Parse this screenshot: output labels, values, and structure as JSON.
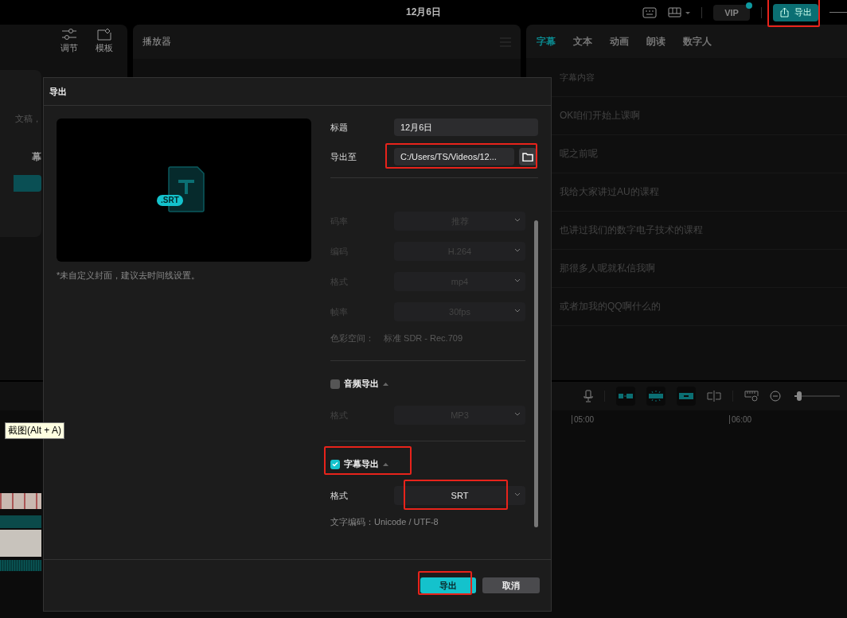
{
  "titlebar": {
    "title": "12月6日",
    "vip": "VIP",
    "export_button": "导出"
  },
  "left_panel": {
    "tabs": [
      {
        "label": "调节",
        "kind": "adjust"
      },
      {
        "label": "模板",
        "kind": "template"
      }
    ],
    "card": {
      "text": "文稿，",
      "heading": "幕"
    }
  },
  "player": {
    "title": "播放器"
  },
  "subtitle_panel": {
    "tabs": [
      {
        "label": "字幕",
        "selected": true
      },
      {
        "label": "文本",
        "selected": false
      },
      {
        "label": "动画",
        "selected": false
      },
      {
        "label": "朗读",
        "selected": false
      },
      {
        "label": "数字人",
        "selected": false
      }
    ],
    "header": "字幕内容",
    "lines": [
      "OK咱们开始上课啊",
      "呢之前呢",
      "我给大家讲过AU的课程",
      "也讲过我们的数字电子技术的课程",
      "那很多人呢就私信我啊",
      "或者加我的QQ啊什么的"
    ]
  },
  "timeline": {
    "ruler": [
      "05:00",
      "06:00"
    ],
    "tooltip": "截图(Alt + A)",
    "zoom": {
      "level": 0.12
    }
  },
  "export_dialog": {
    "title": "导出",
    "file_badge": ".SRT",
    "cover_caption": "*未自定义封面，建议去时间线设置。",
    "fields": [
      {
        "label": "标题",
        "value": "12月6日",
        "kind": "text"
      },
      {
        "label": "导出至",
        "value": "C:/Users/TS/Videos/12...",
        "kind": "path"
      }
    ],
    "settings": [
      {
        "label": "码率",
        "value": "推荐",
        "disabled": true
      },
      {
        "label": "编码",
        "value": "H.264",
        "disabled": true
      },
      {
        "label": "格式",
        "value": "mp4",
        "disabled": true
      },
      {
        "label": "帧率",
        "value": "30fps",
        "disabled": true
      }
    ],
    "color_space": {
      "label": "色彩空间：",
      "value": "标准 SDR - Rec.709"
    },
    "sections": [
      {
        "title": "音频导出",
        "checked": false,
        "rows": [
          {
            "label": "格式",
            "value": "MP3",
            "disabled": true
          }
        ]
      },
      {
        "title": "字幕导出",
        "checked": true,
        "rows": [
          {
            "label": "格式",
            "value": "SRT",
            "disabled": false
          }
        ],
        "note": "文字编码：Unicode / UTF-8"
      }
    ],
    "buttons": [
      {
        "label": "导出",
        "kind": "primary"
      },
      {
        "label": "取消",
        "kind": "secondary"
      }
    ]
  }
}
